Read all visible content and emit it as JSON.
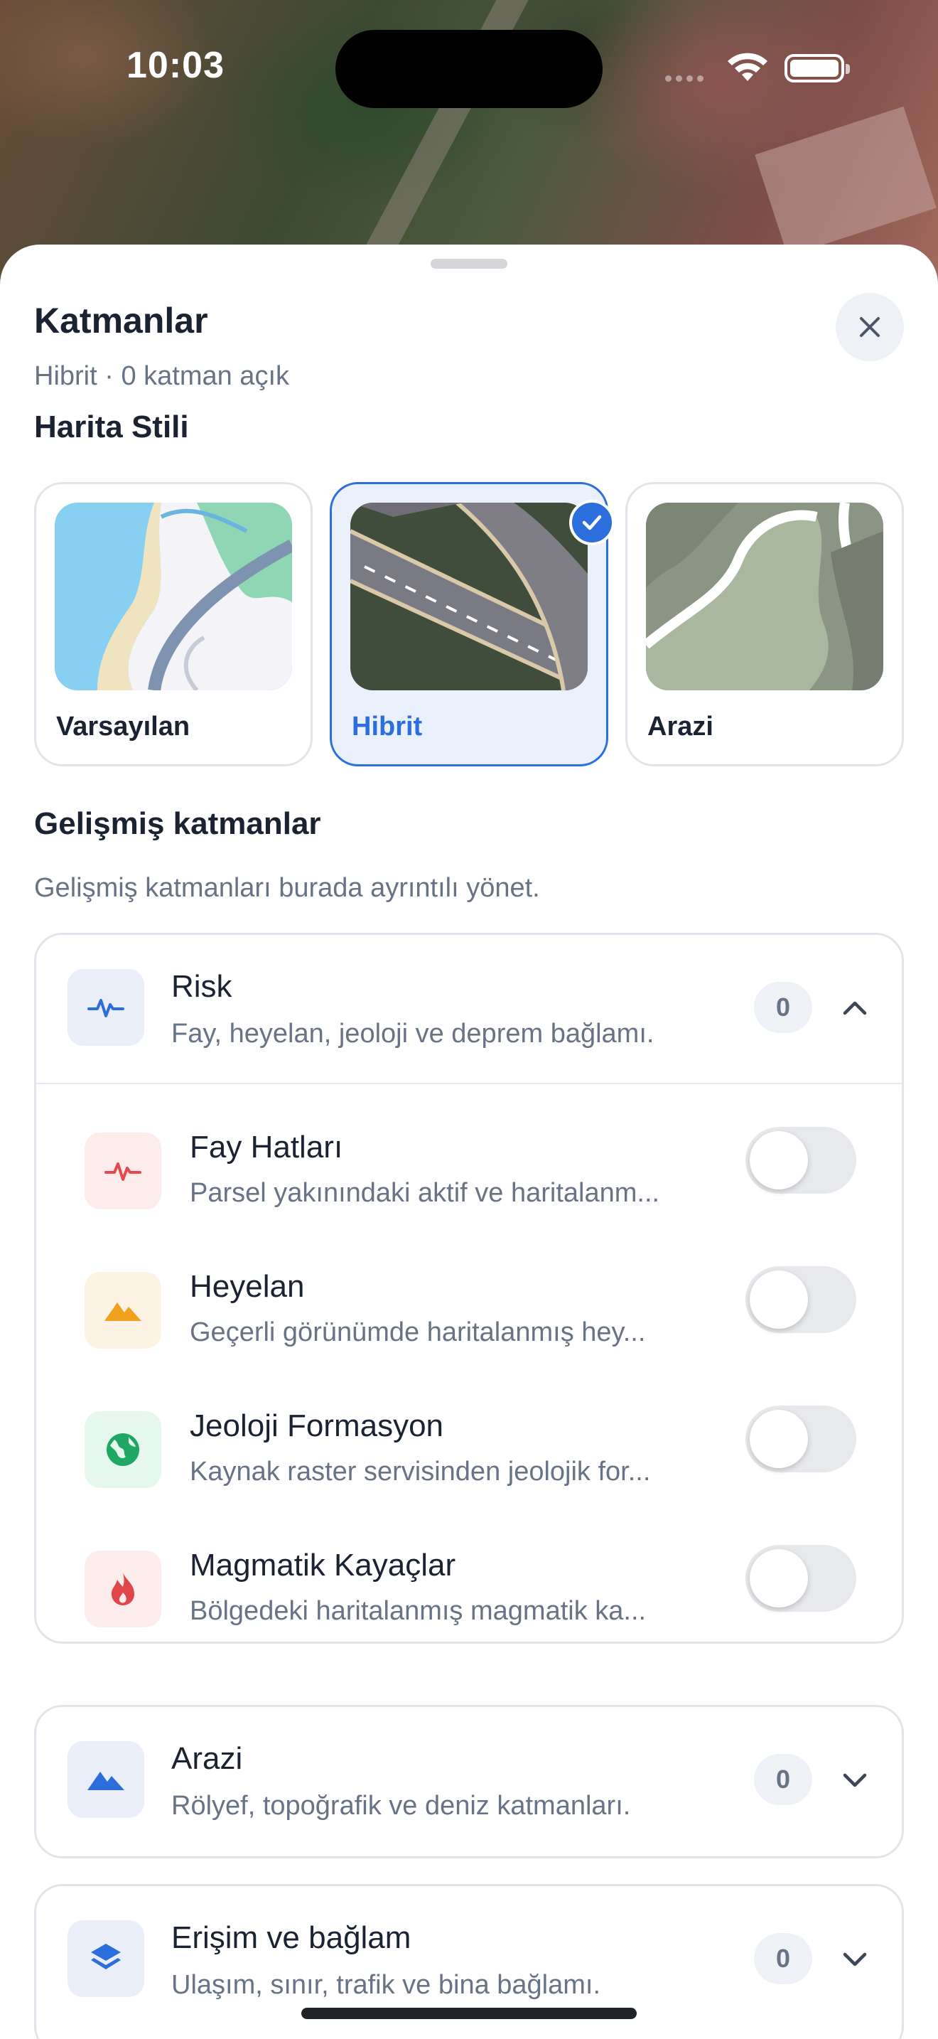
{
  "status_bar": {
    "time": "10:03"
  },
  "sheet": {
    "title": "Katmanlar",
    "subtitle": "Hibrit · 0 katman açık"
  },
  "map_style": {
    "section_title": "Harita Stili",
    "options": [
      {
        "label": "Varsayılan",
        "selected": false
      },
      {
        "label": "Hibrit",
        "selected": true
      },
      {
        "label": "Arazi",
        "selected": false
      }
    ]
  },
  "advanced": {
    "section_title": "Gelişmiş katmanlar",
    "description": "Gelişmiş katmanları burada ayrıntılı yönet."
  },
  "groups": [
    {
      "name": "Risk",
      "description": "Fay, heyelan, jeoloji ve deprem bağlamı.",
      "count": "0",
      "expanded": true,
      "icon": "pulse-icon",
      "layers": [
        {
          "name": "Fay Hatları",
          "description": "Parsel yakınındaki aktif ve haritalanm...",
          "icon": "pulse-icon",
          "enabled": false
        },
        {
          "name": "Heyelan",
          "description": "Geçerli görünümde haritalanmış hey...",
          "icon": "mountain-icon",
          "enabled": false
        },
        {
          "name": "Jeoloji Formasyon",
          "description": "Kaynak raster servisinden jeolojik for...",
          "icon": "globe-icon",
          "enabled": false
        },
        {
          "name": "Magmatik Kayaçlar",
          "description": "Bölgedeki haritalanmış magmatik ka...",
          "icon": "flame-icon",
          "enabled": false
        }
      ]
    },
    {
      "name": "Arazi",
      "description": "Rölyef, topoğrafik ve deniz katmanları.",
      "count": "0",
      "expanded": false,
      "icon": "mountain-icon"
    },
    {
      "name": "Erişim ve bağlam",
      "description": "Ulaşım, sınır, trafik ve bina bağlamı.",
      "count": "0",
      "expanded": false,
      "icon": "layers-icon"
    }
  ],
  "colors": {
    "accent": "#2c6fdc",
    "text_primary": "#1b2333",
    "text_secondary": "#687386",
    "fault_red": "#e5484d",
    "landslide_orange": "#f2a11f",
    "geology_green": "#1fa863",
    "magmatic_red": "#e0454a"
  }
}
